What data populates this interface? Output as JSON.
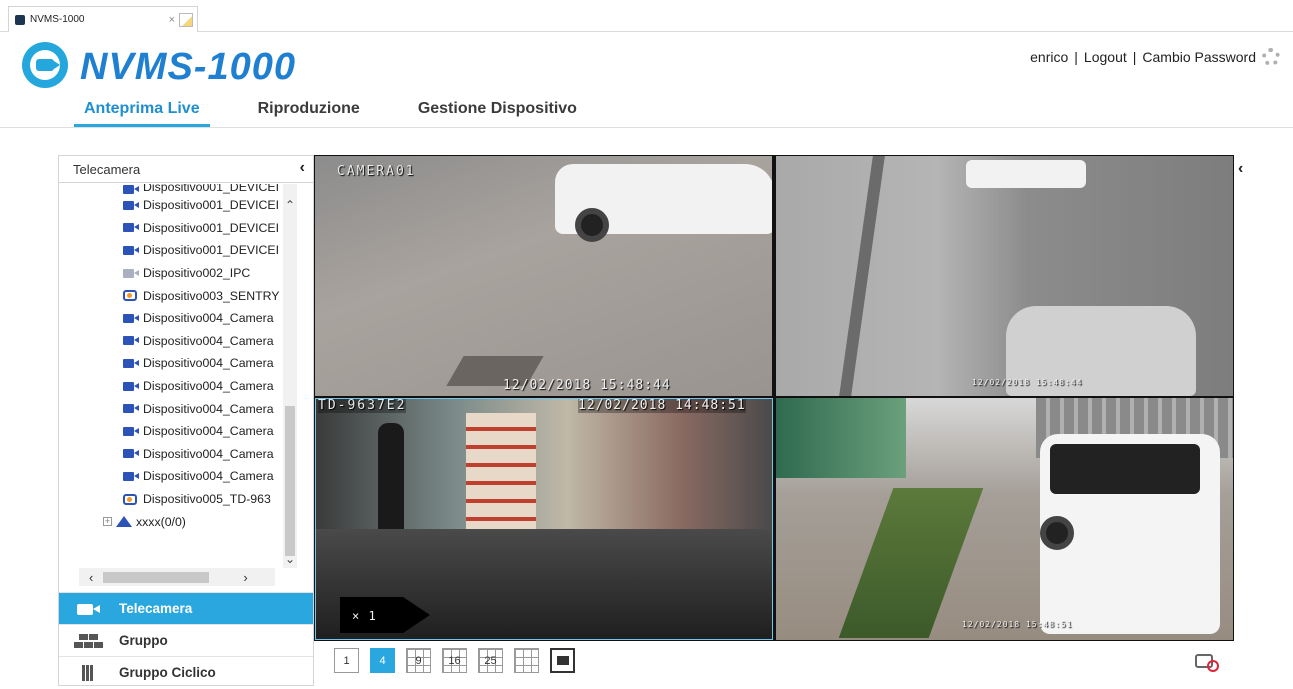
{
  "browser": {
    "tab_title": "NVMS-1000",
    "tab_close": "×"
  },
  "app": {
    "logo_text": "NVMS-1000"
  },
  "nav": {
    "items": [
      {
        "label": "Anteprima Live",
        "active": true
      },
      {
        "label": "Riproduzione",
        "active": false
      },
      {
        "label": "Gestione Dispositivo",
        "active": false
      }
    ]
  },
  "user": {
    "name": "enrico",
    "sep1": "|",
    "logout": "Logout",
    "sep2": "|",
    "change_password": "Cambio Password"
  },
  "panel": {
    "title": "Telecamera",
    "collapse": "‹",
    "tree": [
      {
        "label": "Dispositivo001_DEVICEI",
        "icon": "camera-icon"
      },
      {
        "label": "Dispositivo001_DEVICEI",
        "icon": "camera-icon"
      },
      {
        "label": "Dispositivo001_DEVICEI",
        "icon": "camera-icon"
      },
      {
        "label": "Dispositivo001_DEVICEI",
        "icon": "camera-icon"
      },
      {
        "label": "Dispositivo002_IPC",
        "icon": "camera-offline-icon"
      },
      {
        "label": "Dispositivo003_SENTRY",
        "icon": "dome-camera-icon"
      },
      {
        "label": "Dispositivo004_Camera",
        "icon": "camera-icon"
      },
      {
        "label": "Dispositivo004_Camera",
        "icon": "camera-icon"
      },
      {
        "label": "Dispositivo004_Camera",
        "icon": "camera-icon"
      },
      {
        "label": "Dispositivo004_Camera",
        "icon": "camera-icon"
      },
      {
        "label": "Dispositivo004_Camera",
        "icon": "camera-icon"
      },
      {
        "label": "Dispositivo004_Camera",
        "icon": "camera-icon"
      },
      {
        "label": "Dispositivo004_Camera",
        "icon": "camera-icon"
      },
      {
        "label": "Dispositivo004_Camera",
        "icon": "camera-icon"
      },
      {
        "label": "Dispositivo005_TD-963",
        "icon": "dome-camera-icon"
      }
    ],
    "group": {
      "label": "xxxx(0/0)"
    },
    "menu": [
      {
        "label": "Telecamera",
        "active": true
      },
      {
        "label": "Gruppo",
        "active": false
      },
      {
        "label": "Gruppo Ciclico",
        "active": false
      }
    ]
  },
  "video": {
    "tiles": [
      {
        "label": "CAMERA01",
        "timestamp": "12/02/2018 15:48:44"
      },
      {
        "label": "",
        "timestamp": "12/02/2018 15:48:44"
      },
      {
        "label": "TD-9637E2",
        "timestamp": "12/02/2018 14:48:51",
        "zoom": "× 1"
      },
      {
        "label": "",
        "timestamp": "12/02/2018 15:48:51"
      }
    ],
    "right_collapse": "‹"
  },
  "layouts": [
    {
      "label": "1",
      "active": false
    },
    {
      "label": "4",
      "active": true
    },
    {
      "label": "9",
      "active": false
    },
    {
      "label": "16",
      "active": false
    },
    {
      "label": "25",
      "active": false
    }
  ],
  "colors": {
    "accent": "#2aa7df",
    "logo": "#1f7fd0",
    "tree_icon": "#2c53b8"
  }
}
